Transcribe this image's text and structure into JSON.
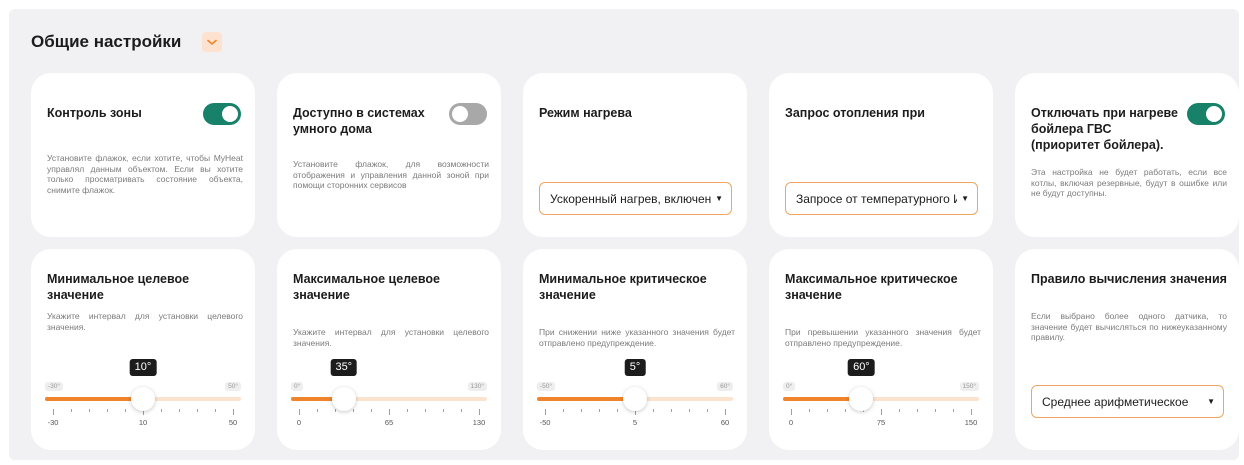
{
  "header": {
    "title": "Общие настройки",
    "collapse_icon": "chevron-down-icon"
  },
  "colors": {
    "accent": "#f0842a",
    "toggle_on": "#188169",
    "toggle_off": "#a8a8a8",
    "select_border": "#f0a560"
  },
  "cards": {
    "zone_control": {
      "title": "Контроль зоны",
      "toggle_on": true,
      "desc": "Установите флажок, если хотите, чтобы MyHeat управлял данным объектом. Если вы хотите только просматривать состояние объекта, снимите флажок."
    },
    "smart_home": {
      "title": "Доступно в системах умного дома",
      "toggle_on": false,
      "desc": "Установите флажок, для возможности отображения и управления данной зоной при помощи сторонних сервисов"
    },
    "heating_mode": {
      "title": "Режим нагрева",
      "selected": "Ускоренный нагрев, включени"
    },
    "heating_request": {
      "title": "Запрос отопления при",
      "selected": "Запросе от температурного И/"
    },
    "dhw_priority": {
      "title": "Отключать при нагреве бойлера ГВС (приоритет бойлера).",
      "toggle_on": true,
      "desc": "Эта настройка не будет работать, если все котлы, включая резервные, будут в ошибке или не будут доступны."
    },
    "min_target": {
      "title": "Минимальное целевое значение",
      "desc": "Укажите интервал для установки целевого значения.",
      "value": 10,
      "value_label": "10°",
      "min": -30,
      "max": 50,
      "min_label": "-30°",
      "max_label": "50°",
      "tick_labels": [
        "-30",
        "10",
        "50"
      ]
    },
    "max_target": {
      "title": "Максимальное целевое значение",
      "desc": "Укажите интервал для установки целевого значения.",
      "value": 35,
      "value_label": "35°",
      "min": 0,
      "max": 130,
      "min_label": "0°",
      "max_label": "130°",
      "tick_labels": [
        "0",
        "65",
        "130"
      ]
    },
    "min_critical": {
      "title": "Минимальное критическое значение",
      "desc": "При снижении ниже указанного значения будет отправлено предупреждение.",
      "value": 5,
      "value_label": "5°",
      "min": -50,
      "max": 60,
      "min_label": "-50°",
      "max_label": "60°",
      "tick_labels": [
        "-50",
        "5",
        "60"
      ]
    },
    "max_critical": {
      "title": "Максимальное критическое значение",
      "desc": "При превышении указанного значения будет отправлено предупреждение.",
      "value": 60,
      "value_label": "60°",
      "min": 0,
      "max": 150,
      "min_label": "0°",
      "max_label": "150°",
      "tick_labels": [
        "0",
        "75",
        "150"
      ]
    },
    "calc_rule": {
      "title": "Правило вычисления значения",
      "desc": "Если выбрано более одного датчика, то значение будет вычисляться по нижеуказанному правилу.",
      "selected": "Среднее арифметическое"
    }
  }
}
